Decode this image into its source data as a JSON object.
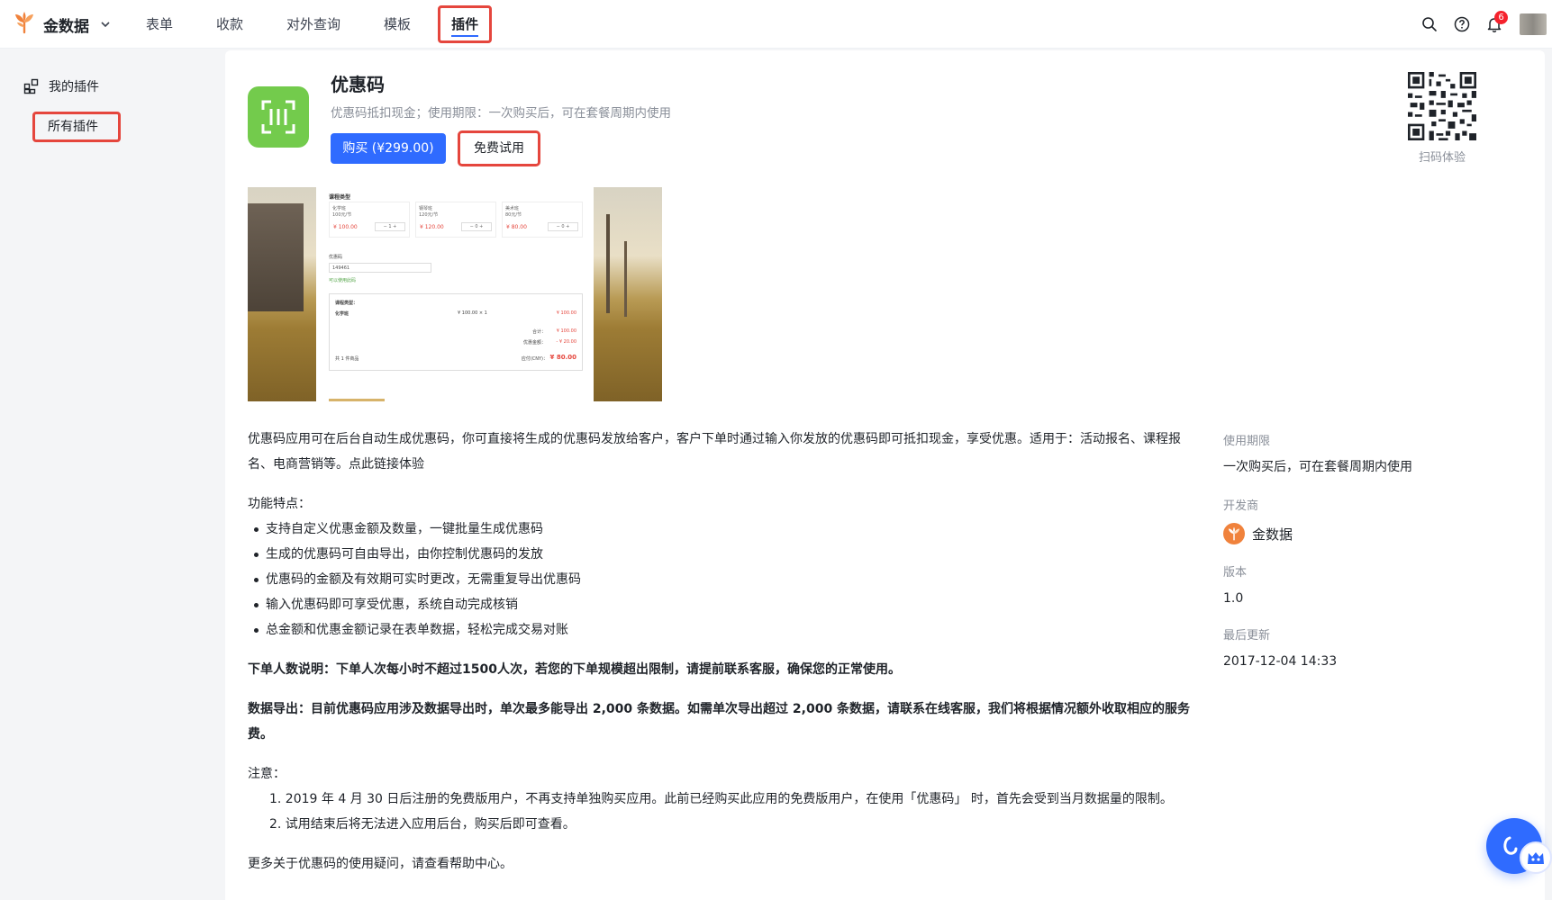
{
  "brand": {
    "name": "金数据"
  },
  "nav": {
    "forms": "表单",
    "payments": "收款",
    "query": "对外查询",
    "templates": "模板",
    "plugins": "插件"
  },
  "notifications": {
    "count": "6"
  },
  "sidebar": {
    "my_plugins": "我的插件",
    "all_plugins": "所有插件"
  },
  "plugin": {
    "title": "优惠码",
    "subtitle": "优惠码抵扣现金；使用期限：一次购买后，可在套餐周期内使用",
    "buy_label": "购买 (¥299.00)",
    "trial_label": "免费试用",
    "qr_label": "扫码体验"
  },
  "preview": {
    "section_title": "课程类型",
    "products": [
      {
        "name": "化学班",
        "unit": "100元/节",
        "price": "¥ 100.00",
        "qty": "1"
      },
      {
        "name": "钢琴班",
        "unit": "120元/节",
        "price": "¥ 120.00",
        "qty": "0"
      },
      {
        "name": "美术班",
        "unit": "80元/节",
        "price": "¥ 80.00",
        "qty": "0"
      }
    ],
    "coupon_label": "优惠码",
    "coupon_value": "149461",
    "coupon_ok": "可以使用此码",
    "summary_title": "课程类型：",
    "summary_item": "化学班",
    "summary_qty": "¥ 100.00 × 1",
    "summary_line": "¥ 100.00",
    "summary_total_label": "合计：",
    "summary_total": "¥ 100.00",
    "summary_discount_label": "优惠金额：",
    "summary_discount": "- ¥ 20.00",
    "summary_footer": "共 1 件商品",
    "summary_pay_label": "应付(CNY)：",
    "summary_pay": "¥ 80.00"
  },
  "description": {
    "intro": "优惠码应用可在后台自动生成优惠码，你可直接将生成的优惠码发放给客户，客户下单时通过输入你发放的优惠码即可抵扣现金，享受优惠。适用于：活动报名、课程报名、电商营销等。点此链接体验",
    "features_title": "功能特点：",
    "features": [
      "支持自定义优惠金额及数量，一键批量生成优惠码",
      "生成的优惠码可自由导出，由你控制优惠码的发放",
      "优惠码的金额及有效期可实时更改，无需重复导出优惠码",
      "输入优惠码即可享受优惠，系统自动完成核销",
      "总金额和优惠金额记录在表单数据，轻松完成交易对账"
    ],
    "order_limit": "下单人数说明：下单人次每小时不超过1500人次，若您的下单规模超出限制，请提前联系客服，确保您的正常使用。",
    "export_note": "数据导出：目前优惠码应用涉及数据导出时，单次最多能导出 2,000 条数据。如需单次导出超过 2,000 条数据，请联系在线客服，我们将根据情况额外收取相应的服务费。",
    "notes_title": "注意：",
    "notes": [
      "1. 2019 年 4 月 30 日后注册的免费版用户，不再支持单独购买应用。此前已经购买此应用的免费版用户，在使用「优惠码」 时，首先会受到当月数据量的限制。",
      "2. 试用结束后将无法进入应用后台，购买后即可查看。"
    ],
    "more_help": "更多关于优惠码的使用疑问，请查看帮助中心。"
  },
  "info": {
    "period_label": "使用期限",
    "period_value": "一次购买后，可在套餐周期内使用",
    "developer_label": "开发商",
    "developer_name": "金数据",
    "version_label": "版本",
    "version_value": "1.0",
    "updated_label": "最后更新",
    "updated_value": "2017-12-04 14:33"
  },
  "colors": {
    "primary": "#2f6bff",
    "plugin_icon": "#73cb4c",
    "highlight": "#e5463d",
    "brand_orange": "#f0823c"
  },
  "icons": [
    "brand-logo-icon",
    "chevron-down-icon",
    "search-icon",
    "help-icon",
    "bell-icon",
    "plugins-icon",
    "scan-icon",
    "qr-code-icon",
    "chat-icon"
  ]
}
